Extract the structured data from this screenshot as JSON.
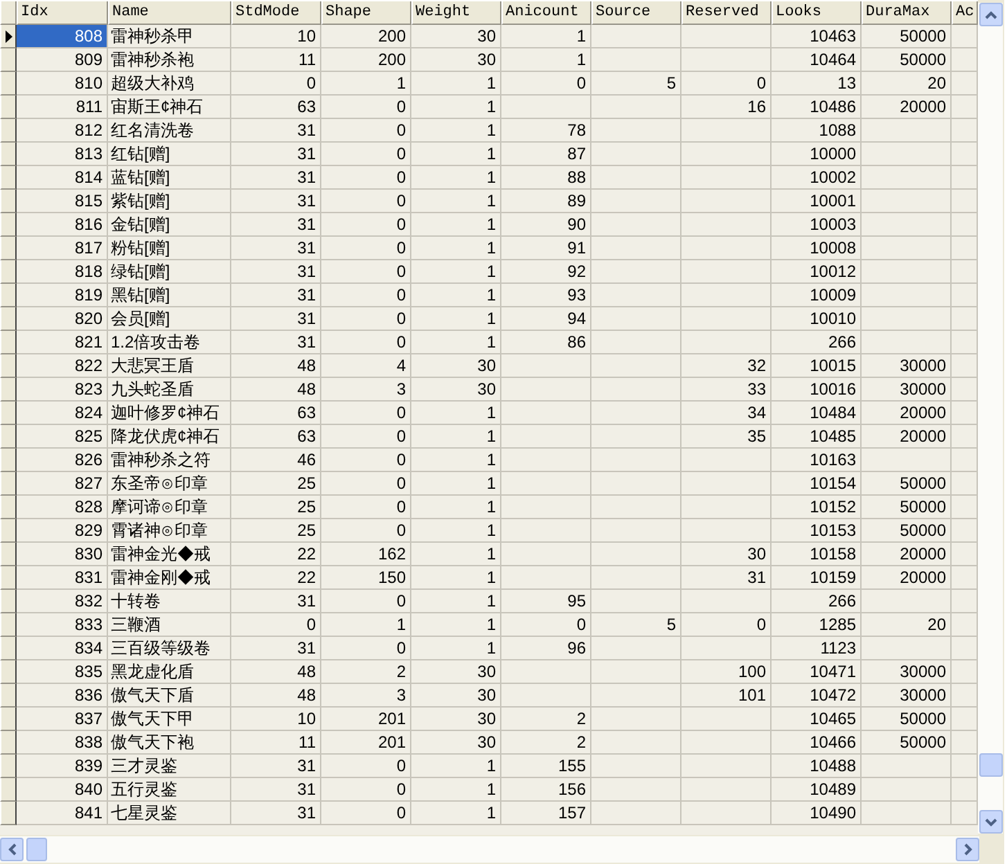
{
  "table": {
    "columns": [
      "Idx",
      "Name",
      "StdMode",
      "Shape",
      "Weight",
      "Anicount",
      "Source",
      "Reserved",
      "Looks",
      "DuraMax",
      "Ac"
    ],
    "rows": [
      {
        "selected": true,
        "cells": [
          "808",
          "雷神秒杀甲",
          "10",
          "200",
          "30",
          "1",
          null,
          null,
          "10463",
          "50000"
        ]
      },
      {
        "selected": false,
        "cells": [
          "809",
          "雷神秒杀袍",
          "11",
          "200",
          "30",
          "1",
          null,
          null,
          "10464",
          "50000"
        ]
      },
      {
        "selected": false,
        "cells": [
          "810",
          "超级大补鸡",
          "0",
          "1",
          "1",
          "0",
          "5",
          "0",
          "13",
          "20"
        ]
      },
      {
        "selected": false,
        "cells": [
          "811",
          "宙斯王¢神石",
          "63",
          "0",
          "1",
          null,
          null,
          "16",
          "10486",
          "20000"
        ]
      },
      {
        "selected": false,
        "cells": [
          "812",
          "红名清洗卷",
          "31",
          "0",
          "1",
          "78",
          null,
          null,
          "1088",
          null
        ]
      },
      {
        "selected": false,
        "cells": [
          "813",
          "红钻[赠]",
          "31",
          "0",
          "1",
          "87",
          null,
          null,
          "10000",
          null
        ]
      },
      {
        "selected": false,
        "cells": [
          "814",
          "蓝钻[赠]",
          "31",
          "0",
          "1",
          "88",
          null,
          null,
          "10002",
          null
        ]
      },
      {
        "selected": false,
        "cells": [
          "815",
          "紫钻[赠]",
          "31",
          "0",
          "1",
          "89",
          null,
          null,
          "10001",
          null
        ]
      },
      {
        "selected": false,
        "cells": [
          "816",
          "金钻[赠]",
          "31",
          "0",
          "1",
          "90",
          null,
          null,
          "10003",
          null
        ]
      },
      {
        "selected": false,
        "cells": [
          "817",
          "粉钻[赠]",
          "31",
          "0",
          "1",
          "91",
          null,
          null,
          "10008",
          null
        ]
      },
      {
        "selected": false,
        "cells": [
          "818",
          "绿钻[赠]",
          "31",
          "0",
          "1",
          "92",
          null,
          null,
          "10012",
          null
        ]
      },
      {
        "selected": false,
        "cells": [
          "819",
          "黑钻[赠]",
          "31",
          "0",
          "1",
          "93",
          null,
          null,
          "10009",
          null
        ]
      },
      {
        "selected": false,
        "cells": [
          "820",
          "会员[赠]",
          "31",
          "0",
          "1",
          "94",
          null,
          null,
          "10010",
          null
        ]
      },
      {
        "selected": false,
        "cells": [
          "821",
          "1.2倍攻击卷",
          "31",
          "0",
          "1",
          "86",
          null,
          null,
          "266",
          null
        ]
      },
      {
        "selected": false,
        "cells": [
          "822",
          "大悲冥王盾",
          "48",
          "4",
          "30",
          null,
          null,
          "32",
          "10015",
          "30000"
        ]
      },
      {
        "selected": false,
        "cells": [
          "823",
          "九头蛇圣盾",
          "48",
          "3",
          "30",
          null,
          null,
          "33",
          "10016",
          "30000"
        ]
      },
      {
        "selected": false,
        "cells": [
          "824",
          "迦叶修罗¢神石",
          "63",
          "0",
          "1",
          null,
          null,
          "34",
          "10484",
          "20000"
        ]
      },
      {
        "selected": false,
        "cells": [
          "825",
          "降龙伏虎¢神石",
          "63",
          "0",
          "1",
          null,
          null,
          "35",
          "10485",
          "20000"
        ]
      },
      {
        "selected": false,
        "cells": [
          "826",
          "雷神秒杀之符",
          "46",
          "0",
          "1",
          null,
          null,
          null,
          "10163",
          null
        ]
      },
      {
        "selected": false,
        "cells": [
          "827",
          "东圣帝⊙印章",
          "25",
          "0",
          "1",
          null,
          null,
          null,
          "10154",
          "50000"
        ]
      },
      {
        "selected": false,
        "cells": [
          "828",
          "摩诃谛⊙印章",
          "25",
          "0",
          "1",
          null,
          null,
          null,
          "10152",
          "50000"
        ]
      },
      {
        "selected": false,
        "cells": [
          "829",
          "霄诸神⊙印章",
          "25",
          "0",
          "1",
          null,
          null,
          null,
          "10153",
          "50000"
        ]
      },
      {
        "selected": false,
        "cells": [
          "830",
          "雷神金光◆戒",
          "22",
          "162",
          "1",
          null,
          null,
          "30",
          "10158",
          "20000"
        ]
      },
      {
        "selected": false,
        "cells": [
          "831",
          "雷神金刚◆戒",
          "22",
          "150",
          "1",
          null,
          null,
          "31",
          "10159",
          "20000"
        ]
      },
      {
        "selected": false,
        "cells": [
          "832",
          "十转卷",
          "31",
          "0",
          "1",
          "95",
          null,
          null,
          "266",
          null
        ]
      },
      {
        "selected": false,
        "cells": [
          "833",
          "三鞭酒",
          "0",
          "1",
          "1",
          "0",
          "5",
          "0",
          "1285",
          "20"
        ]
      },
      {
        "selected": false,
        "cells": [
          "834",
          "三百级等级卷",
          "31",
          "0",
          "1",
          "96",
          null,
          null,
          "1123",
          null
        ]
      },
      {
        "selected": false,
        "cells": [
          "835",
          "黑龙虚化盾",
          "48",
          "2",
          "30",
          null,
          null,
          "100",
          "10471",
          "30000"
        ]
      },
      {
        "selected": false,
        "cells": [
          "836",
          "傲气天下盾",
          "48",
          "3",
          "30",
          null,
          null,
          "101",
          "10472",
          "30000"
        ]
      },
      {
        "selected": false,
        "cells": [
          "837",
          "傲气天下甲",
          "10",
          "201",
          "30",
          "2",
          null,
          null,
          "10465",
          "50000"
        ]
      },
      {
        "selected": false,
        "cells": [
          "838",
          "傲气天下袍",
          "11",
          "201",
          "30",
          "2",
          null,
          null,
          "10466",
          "50000"
        ]
      },
      {
        "selected": false,
        "cells": [
          "839",
          "三才灵鉴",
          "31",
          "0",
          "1",
          "155",
          null,
          null,
          "10488",
          null
        ]
      },
      {
        "selected": false,
        "cells": [
          "840",
          "五行灵鉴",
          "31",
          "0",
          "1",
          "156",
          null,
          null,
          "10489",
          null
        ]
      },
      {
        "selected": false,
        "cells": [
          "841",
          "七星灵鉴",
          "31",
          "0",
          "1",
          "157",
          null,
          null,
          "10490",
          null
        ]
      }
    ]
  }
}
